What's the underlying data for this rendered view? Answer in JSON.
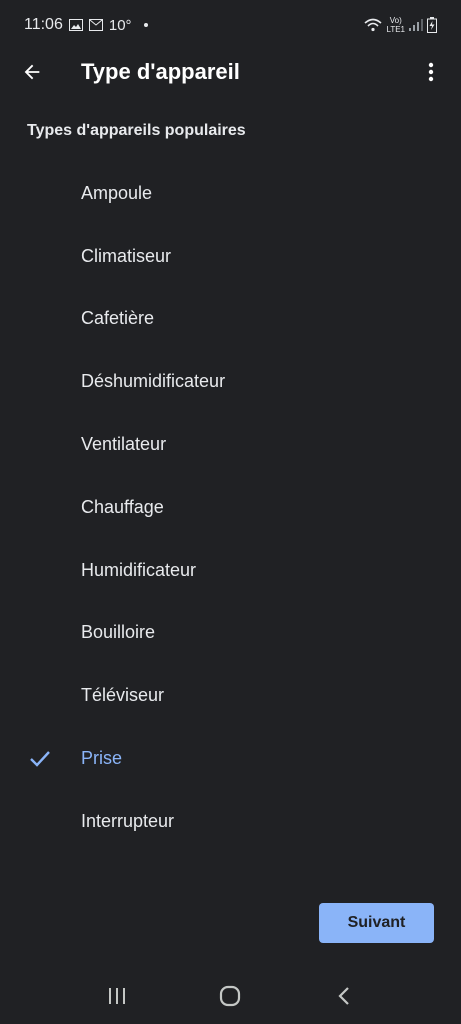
{
  "status_bar": {
    "time": "11:06",
    "temperature": "10°",
    "network": "LTE1"
  },
  "app_bar": {
    "title": "Type d'appareil"
  },
  "section": {
    "header": "Types d'appareils populaires"
  },
  "devices": [
    {
      "label": "Ampoule",
      "selected": false
    },
    {
      "label": "Climatiseur",
      "selected": false
    },
    {
      "label": "Cafetière",
      "selected": false
    },
    {
      "label": "Déshumidificateur",
      "selected": false
    },
    {
      "label": "Ventilateur",
      "selected": false
    },
    {
      "label": "Chauffage",
      "selected": false
    },
    {
      "label": "Humidificateur",
      "selected": false
    },
    {
      "label": "Bouilloire",
      "selected": false
    },
    {
      "label": "Téléviseur",
      "selected": false
    },
    {
      "label": "Prise",
      "selected": true
    },
    {
      "label": "Interrupteur",
      "selected": false
    }
  ],
  "actions": {
    "next_label": "Suivant"
  },
  "colors": {
    "background": "#202124",
    "accent": "#8ab4f8",
    "text": "#e8eaed"
  }
}
